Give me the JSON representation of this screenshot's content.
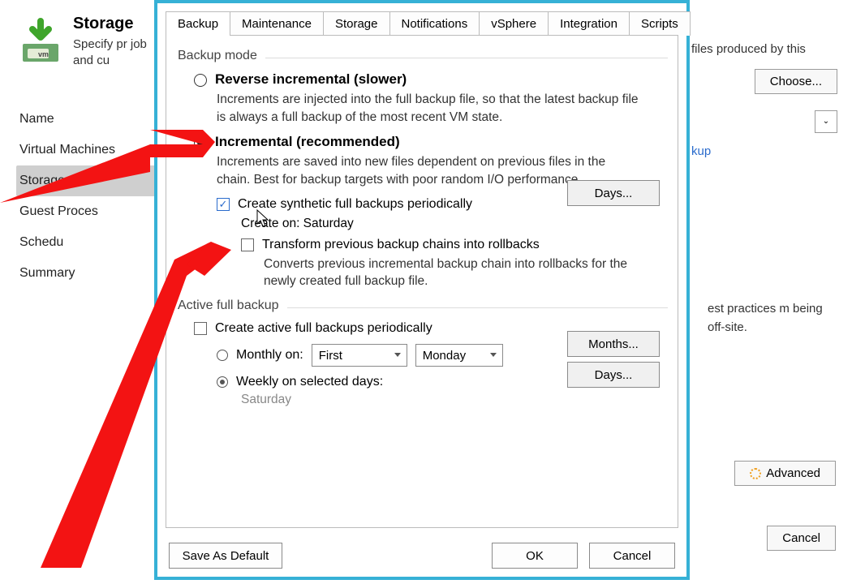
{
  "left": {
    "title": "Storage",
    "subtitle": "Specify pr job and cu",
    "nav": [
      "Name",
      "Virtual Machines",
      "Storage",
      "Guest Proces",
      "Schedu",
      "Summary"
    ],
    "active_index": 2
  },
  "bg": {
    "text_top": "files produced by this",
    "choose": "Choose...",
    "link_fragment": "kup",
    "practices": "est practices m being off-site.",
    "advanced": "Advanced",
    "cancel": "Cancel"
  },
  "dialog": {
    "tabs": [
      "Backup",
      "Maintenance",
      "Storage",
      "Notifications",
      "vSphere",
      "Integration",
      "Scripts"
    ],
    "active_tab": 0,
    "group_backup_mode": "Backup mode",
    "reverse": {
      "title": "Reverse incremental (slower)",
      "desc": "Increments are injected into the full backup file, so that the latest backup file is always a full backup of the most recent VM state."
    },
    "incremental": {
      "title": "Incremental (recommended)",
      "desc": "Increments are saved into new files dependent on previous files in the chain. Best for backup targets with poor random I/O performance.",
      "synthetic_chk": "Create synthetic full backups periodically",
      "create_on": "Create on:  Saturday",
      "transform_chk": "Transform previous backup chains into rollbacks",
      "transform_desc": "Converts previous incremental backup chain into rollbacks for the newly created full backup file."
    },
    "days_btn": "Days...",
    "group_active": "Active full backup",
    "active_chk": "Create active full backups periodically",
    "monthly_label": "Monthly on:",
    "monthly_first": "First",
    "monthly_day": "Monday",
    "months_btn": "Months...",
    "weekly_label": "Weekly on selected days:",
    "weekly_value": "Saturday",
    "footer": {
      "save": "Save As Default",
      "ok": "OK",
      "cancel": "Cancel"
    }
  }
}
